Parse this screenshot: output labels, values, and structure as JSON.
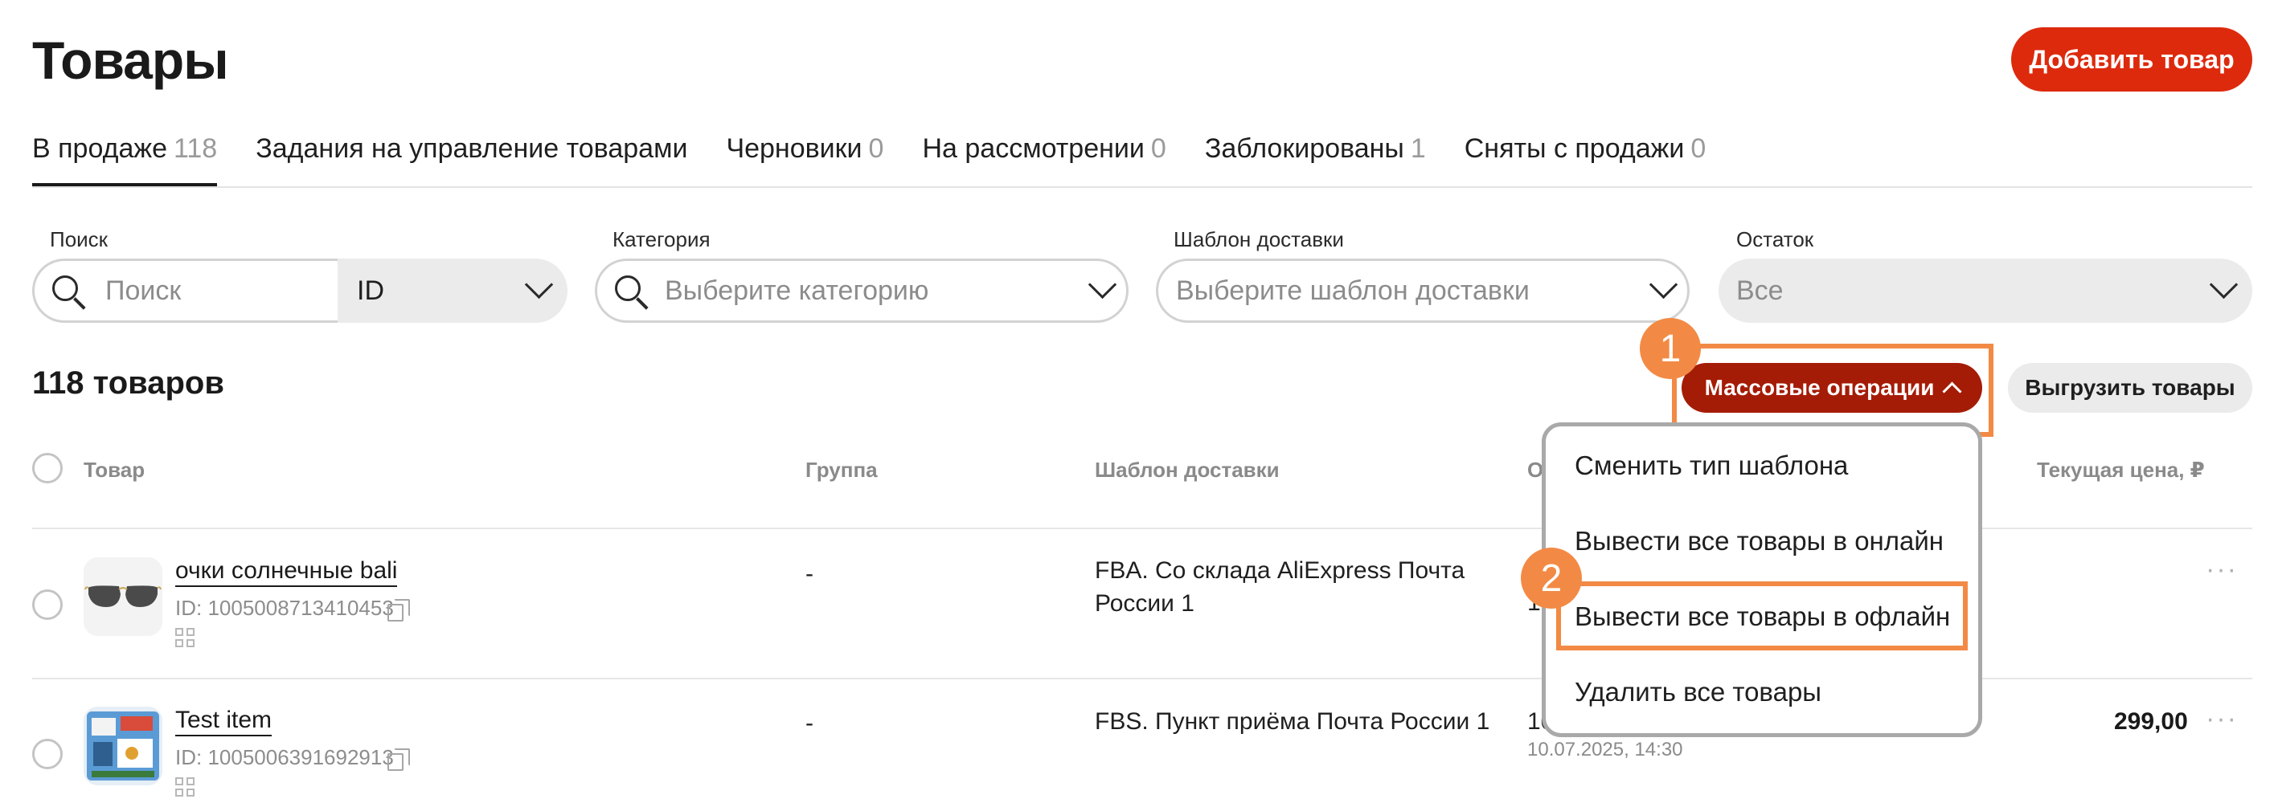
{
  "header": {
    "title": "Товары",
    "add_button": "Добавить товар"
  },
  "tabs": [
    {
      "label": "В продаже",
      "count": "118",
      "active": true
    },
    {
      "label": "Задания на управление товарами",
      "count": ""
    },
    {
      "label": "Черновики",
      "count": "0"
    },
    {
      "label": "На рассмотрении",
      "count": "0"
    },
    {
      "label": "Заблокированы",
      "count": "1"
    },
    {
      "label": "Сняты с продажи",
      "count": "0"
    }
  ],
  "filters": {
    "search": {
      "label": "Поиск",
      "placeholder": "Поиск",
      "type_value": "ID"
    },
    "category": {
      "label": "Категория",
      "placeholder": "Выберите категорию"
    },
    "delivery": {
      "label": "Шаблон доставки",
      "placeholder": "Выберите шаблон доставки"
    },
    "stock": {
      "label": "Остаток",
      "value": "Все"
    }
  },
  "results": {
    "count_label": "118 товаров",
    "mass_ops_button": "Массовые операции",
    "export_button": "Выгрузить товары"
  },
  "table": {
    "columns": {
      "product": "Товар",
      "group": "Группа",
      "delivery": "Шаблон доставки",
      "remain_partial": "О",
      "price": "Текущая цена, ₽"
    },
    "rows": [
      {
        "name": "очки солнечные bali",
        "id": "ID: 1005008713410453",
        "group": "-",
        "delivery": "FBA. Со склада AliExpress Почта России 1",
        "remain_partial": "1",
        "price": ""
      },
      {
        "name": "Test item",
        "id": "ID: 1005006391692913",
        "group": "-",
        "delivery": "FBS. Пункт приёма Почта России 1",
        "remain_partial": "10",
        "date": "10.07.2025, 14:30",
        "price": "299,00"
      }
    ]
  },
  "menu": {
    "items": [
      "Сменить тип шаблона",
      "Вывести все товары в онлайн",
      "Вывести все товары в офлайн",
      "Удалить все товары"
    ]
  },
  "annotations": {
    "badge_1": "1",
    "badge_2": "2"
  },
  "colors": {
    "accent": "#dd2a0d",
    "accent_dark": "#a51c06",
    "highlight": "#f28a45"
  }
}
